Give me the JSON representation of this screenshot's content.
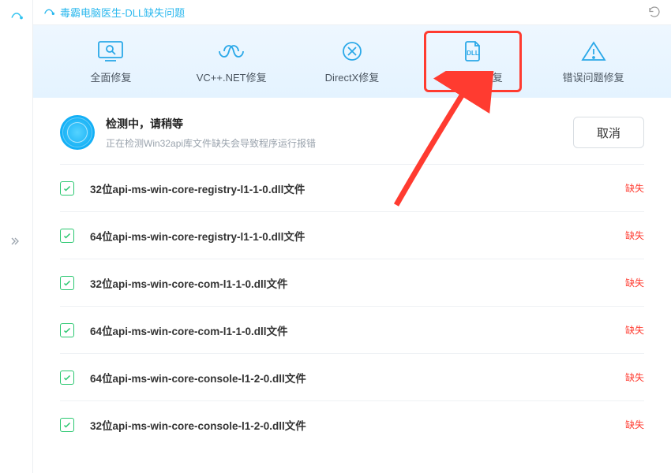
{
  "window": {
    "title": "毒霸电脑医生-DLL缺失问题"
  },
  "tabs": [
    {
      "id": "full",
      "label": "全面修复"
    },
    {
      "id": "vcnet",
      "label": "VC++.NET修复"
    },
    {
      "id": "directx",
      "label": "DirectX修复"
    },
    {
      "id": "sysdll",
      "label": "系统DLL修复",
      "selected": true
    },
    {
      "id": "error",
      "label": "错误问题修复"
    }
  ],
  "status": {
    "title": "检测中，请稍等",
    "subtitle": "正在检测Win32api库文件缺失会导致程序运行报错",
    "cancel_label": "取消"
  },
  "rows": [
    {
      "name": "32位api-ms-win-core-registry-l1-1-0.dll文件",
      "state": "缺失",
      "checked": true
    },
    {
      "name": "64位api-ms-win-core-registry-l1-1-0.dll文件",
      "state": "缺失",
      "checked": true
    },
    {
      "name": "32位api-ms-win-core-com-l1-1-0.dll文件",
      "state": "缺失",
      "checked": true
    },
    {
      "name": "64位api-ms-win-core-com-l1-1-0.dll文件",
      "state": "缺失",
      "checked": true
    },
    {
      "name": "64位api-ms-win-core-console-l1-2-0.dll文件",
      "state": "缺失",
      "checked": true
    },
    {
      "name": "32位api-ms-win-core-console-l1-2-0.dll文件",
      "state": "缺失",
      "checked": true
    }
  ],
  "colors": {
    "accent": "#2aa8e8",
    "danger": "#ff3b30",
    "ok": "#29c76f"
  }
}
